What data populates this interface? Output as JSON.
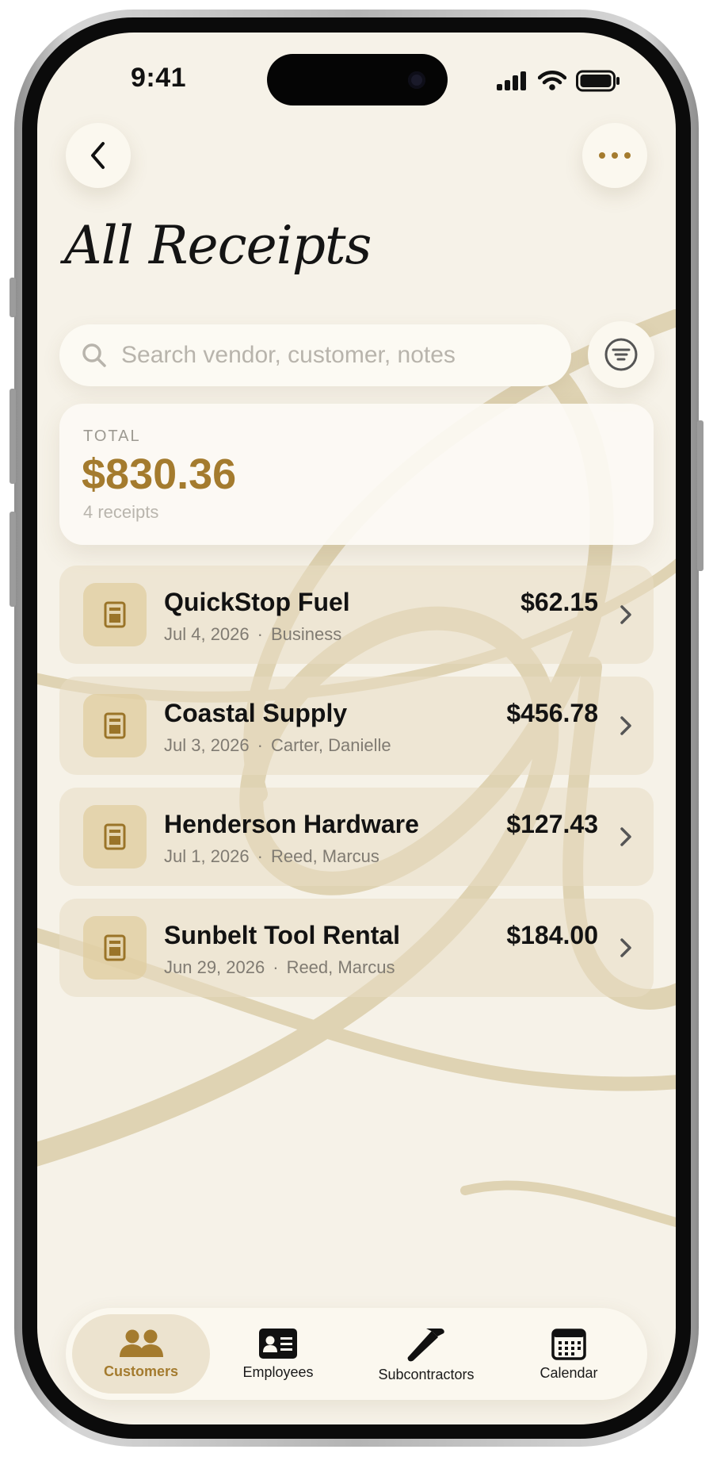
{
  "status_bar": {
    "time": "9:41"
  },
  "header": {
    "title": "All Receipts"
  },
  "search": {
    "placeholder": "Search vendor, customer, notes",
    "value": ""
  },
  "summary": {
    "label": "TOTAL",
    "amount": "$830.36",
    "count": "4 receipts"
  },
  "receipts": [
    {
      "vendor": "QuickStop Fuel",
      "date": "Jul 4, 2026",
      "party": "Business",
      "amount": "$62.15"
    },
    {
      "vendor": "Coastal Supply",
      "date": "Jul 3, 2026",
      "party": "Carter, Danielle",
      "amount": "$456.78"
    },
    {
      "vendor": "Henderson Hardware",
      "date": "Jul 1, 2026",
      "party": "Reed, Marcus",
      "amount": "$127.43"
    },
    {
      "vendor": "Sunbelt Tool Rental",
      "date": "Jun 29, 2026",
      "party": "Reed, Marcus",
      "amount": "$184.00"
    }
  ],
  "meta_separator": "·",
  "tabs": [
    {
      "label": "Customers",
      "icon": "people-icon",
      "active": true
    },
    {
      "label": "Employees",
      "icon": "id-card-icon",
      "active": false
    },
    {
      "label": "Subcontractors",
      "icon": "hammer-icon",
      "active": false
    },
    {
      "label": "Calendar",
      "icon": "calendar-icon",
      "active": false
    }
  ],
  "colors": {
    "background": "#f6f2e8",
    "accent_gold": "#a47b2e",
    "row_tint": "#e8ddc3",
    "text_primary": "#121212"
  }
}
